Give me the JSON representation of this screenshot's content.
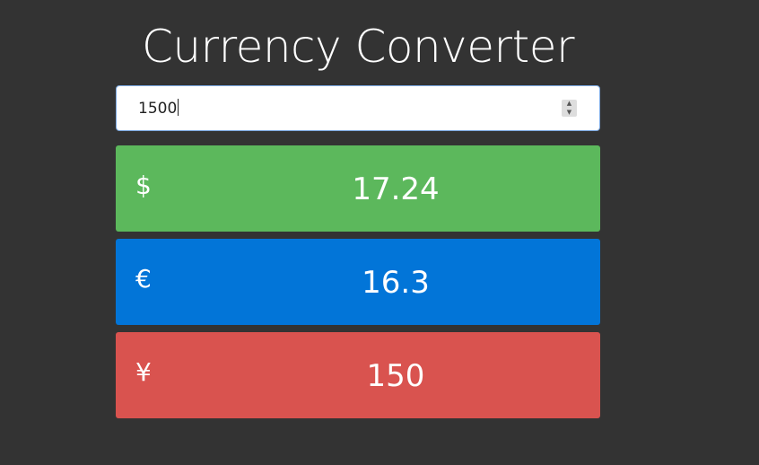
{
  "app": {
    "title": "Currency Converter"
  },
  "amount_input": {
    "value": "1500"
  },
  "conversions": [
    {
      "symbol": "$",
      "value": "17.24",
      "color": "#5cb85c"
    },
    {
      "symbol": "€",
      "value": "16.3",
      "color": "#0275d8"
    },
    {
      "symbol": "¥",
      "value": "150",
      "color": "#d9534f"
    }
  ],
  "colors": {
    "background": "#333333",
    "input_border": "#7aa7e0"
  },
  "icons": {
    "spinner_up": "chevron-up-icon",
    "spinner_down": "chevron-down-icon"
  }
}
